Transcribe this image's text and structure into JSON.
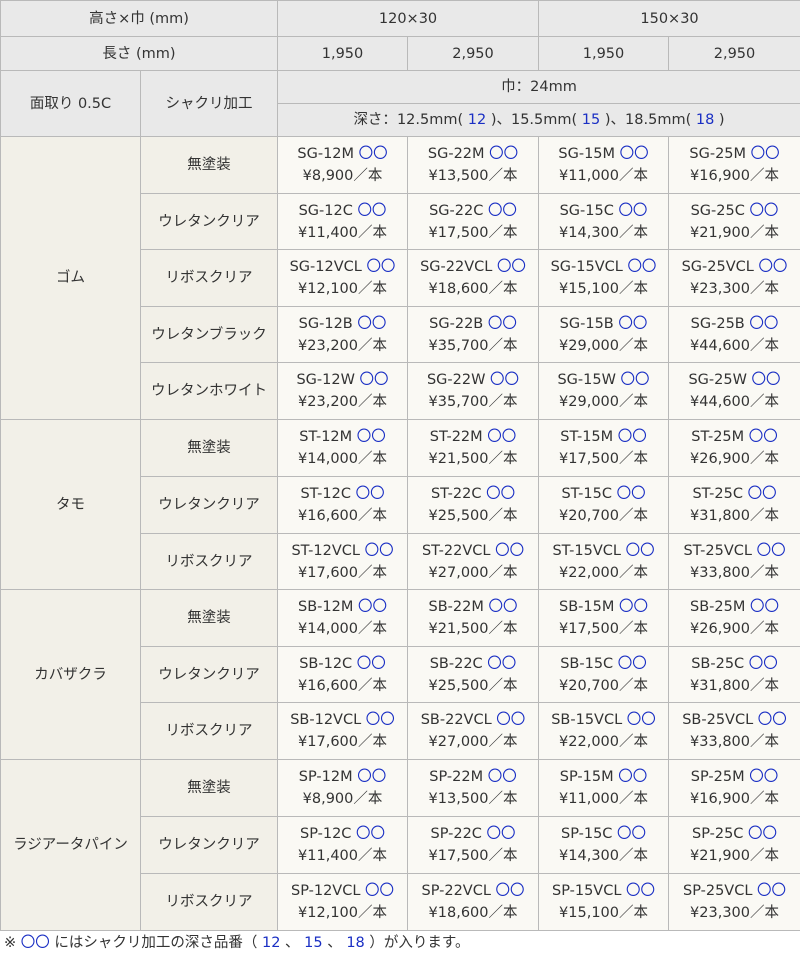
{
  "header": {
    "size_label": "高さ×巾 (mm)",
    "length_label": "長さ (mm)",
    "chamfer_label": "面取り 0.5C",
    "groove_label": "シャクリ加工",
    "sizes": [
      "120×30",
      "150×30"
    ],
    "lengths": [
      "1,950",
      "2,950",
      "1,950",
      "2,950"
    ],
    "width_note": "巾：24mm",
    "depth": {
      "prefix": "深さ：",
      "d1": "12.5mm(",
      "c1": "12",
      "d2": "15.5mm(",
      "c2": "15",
      "d3": "18.5mm(",
      "c3": "18",
      "close": ")",
      "close_sep": ")、",
      "close_end": ")"
    }
  },
  "placeholder": "〇〇",
  "materials": [
    {
      "name": "ゴム",
      "rows": [
        {
          "finish": "無塗装",
          "items": [
            {
              "code": "SG-12M",
              "price": "¥8,900／本"
            },
            {
              "code": "SG-22M",
              "price": "¥13,500／本"
            },
            {
              "code": "SG-15M",
              "price": "¥11,000／本"
            },
            {
              "code": "SG-25M",
              "price": "¥16,900／本"
            }
          ]
        },
        {
          "finish": "ウレタンクリア",
          "items": [
            {
              "code": "SG-12C",
              "price": "¥11,400／本"
            },
            {
              "code": "SG-22C",
              "price": "¥17,500／本"
            },
            {
              "code": "SG-15C",
              "price": "¥14,300／本"
            },
            {
              "code": "SG-25C",
              "price": "¥21,900／本"
            }
          ]
        },
        {
          "finish": "リボスクリア",
          "items": [
            {
              "code": "SG-12VCL",
              "price": "¥12,100／本"
            },
            {
              "code": "SG-22VCL",
              "price": "¥18,600／本"
            },
            {
              "code": "SG-15VCL",
              "price": "¥15,100／本"
            },
            {
              "code": "SG-25VCL",
              "price": "¥23,300／本"
            }
          ]
        },
        {
          "finish": "ウレタンブラック",
          "items": [
            {
              "code": "SG-12B",
              "price": "¥23,200／本"
            },
            {
              "code": "SG-22B",
              "price": "¥35,700／本"
            },
            {
              "code": "SG-15B",
              "price": "¥29,000／本"
            },
            {
              "code": "SG-25B",
              "price": "¥44,600／本"
            }
          ]
        },
        {
          "finish": "ウレタンホワイト",
          "items": [
            {
              "code": "SG-12W",
              "price": "¥23,200／本"
            },
            {
              "code": "SG-22W",
              "price": "¥35,700／本"
            },
            {
              "code": "SG-15W",
              "price": "¥29,000／本"
            },
            {
              "code": "SG-25W",
              "price": "¥44,600／本"
            }
          ]
        }
      ]
    },
    {
      "name": "タモ",
      "rows": [
        {
          "finish": "無塗装",
          "items": [
            {
              "code": "ST-12M",
              "price": "¥14,000／本"
            },
            {
              "code": "ST-22M",
              "price": "¥21,500／本"
            },
            {
              "code": "ST-15M",
              "price": "¥17,500／本"
            },
            {
              "code": "ST-25M",
              "price": "¥26,900／本"
            }
          ]
        },
        {
          "finish": "ウレタンクリア",
          "items": [
            {
              "code": "ST-12C",
              "price": "¥16,600／本"
            },
            {
              "code": "ST-22C",
              "price": "¥25,500／本"
            },
            {
              "code": "ST-15C",
              "price": "¥20,700／本"
            },
            {
              "code": "ST-25C",
              "price": "¥31,800／本"
            }
          ]
        },
        {
          "finish": "リボスクリア",
          "items": [
            {
              "code": "ST-12VCL",
              "price": "¥17,600／本"
            },
            {
              "code": "ST-22VCL",
              "price": "¥27,000／本"
            },
            {
              "code": "ST-15VCL",
              "price": "¥22,000／本"
            },
            {
              "code": "ST-25VCL",
              "price": "¥33,800／本"
            }
          ]
        }
      ]
    },
    {
      "name": "カバザクラ",
      "rows": [
        {
          "finish": "無塗装",
          "items": [
            {
              "code": "SB-12M",
              "price": "¥14,000／本"
            },
            {
              "code": "SB-22M",
              "price": "¥21,500／本"
            },
            {
              "code": "SB-15M",
              "price": "¥17,500／本"
            },
            {
              "code": "SB-25M",
              "price": "¥26,900／本"
            }
          ]
        },
        {
          "finish": "ウレタンクリア",
          "items": [
            {
              "code": "SB-12C",
              "price": "¥16,600／本"
            },
            {
              "code": "SB-22C",
              "price": "¥25,500／本"
            },
            {
              "code": "SB-15C",
              "price": "¥20,700／本"
            },
            {
              "code": "SB-25C",
              "price": "¥31,800／本"
            }
          ]
        },
        {
          "finish": "リボスクリア",
          "items": [
            {
              "code": "SB-12VCL",
              "price": "¥17,600／本"
            },
            {
              "code": "SB-22VCL",
              "price": "¥27,000／本"
            },
            {
              "code": "SB-15VCL",
              "price": "¥22,000／本"
            },
            {
              "code": "SB-25VCL",
              "price": "¥33,800／本"
            }
          ]
        }
      ]
    },
    {
      "name": "ラジアータパイン",
      "rows": [
        {
          "finish": "無塗装",
          "items": [
            {
              "code": "SP-12M",
              "price": "¥8,900／本"
            },
            {
              "code": "SP-22M",
              "price": "¥13,500／本"
            },
            {
              "code": "SP-15M",
              "price": "¥11,000／本"
            },
            {
              "code": "SP-25M",
              "price": "¥16,900／本"
            }
          ]
        },
        {
          "finish": "ウレタンクリア",
          "items": [
            {
              "code": "SP-12C",
              "price": "¥11,400／本"
            },
            {
              "code": "SP-22C",
              "price": "¥17,500／本"
            },
            {
              "code": "SP-15C",
              "price": "¥14,300／本"
            },
            {
              "code": "SP-25C",
              "price": "¥21,900／本"
            }
          ]
        },
        {
          "finish": "リボスクリア",
          "items": [
            {
              "code": "SP-12VCL",
              "price": "¥12,100／本"
            },
            {
              "code": "SP-22VCL",
              "price": "¥18,600／本"
            },
            {
              "code": "SP-15VCL",
              "price": "¥15,100／本"
            },
            {
              "code": "SP-25VCL",
              "price": "¥23,300／本"
            }
          ]
        }
      ]
    }
  ],
  "footer": {
    "mark": "※",
    "placeholder": "〇〇",
    "text1": "にはシャクリ加工の深さ品番（",
    "codes": [
      "12",
      "15",
      "18"
    ],
    "sep": "、",
    "text2": "）が入ります。"
  },
  "colors": {
    "header_bg": "#e9e9e9",
    "label_bg": "#f2f0e8",
    "cell_bg": "#faf9f4",
    "border": "#b9b9b9",
    "text": "#333333",
    "accent_blue": "#1a2fc4"
  }
}
